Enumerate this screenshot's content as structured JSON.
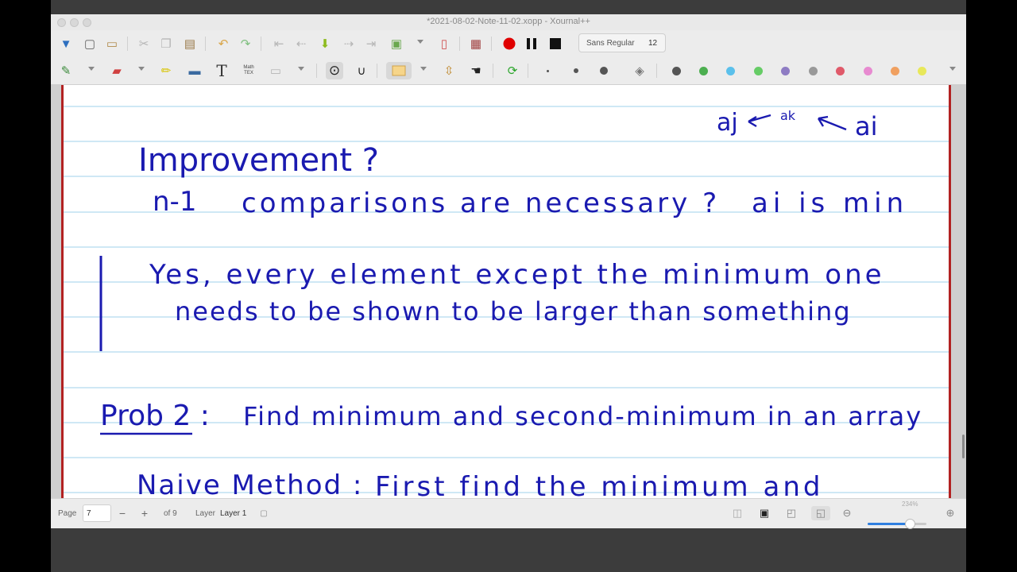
{
  "window": {
    "title": "*2021-08-02-Note-11-02.xopp - Xournal++"
  },
  "toolbar": {
    "font_name": "Sans Regular",
    "font_size": "12",
    "math_tex_label_top": "Math",
    "math_tex_label_bottom": "TEX",
    "text_tool_label": "T",
    "pen_color": "#1a1ab0",
    "palette": [
      "#555555",
      "#4caf50",
      "#5bc0eb",
      "#66cc66",
      "#8e7cc3",
      "#999999",
      "#e05a6a",
      "#e78ad0",
      "#f0a060",
      "#e8e85a"
    ],
    "record_color": "#e00000"
  },
  "note": {
    "annotation_top_right": [
      "aj",
      "ak",
      "ai"
    ],
    "line1": "Improvement ?",
    "line2_a": "n-1",
    "line2_b": "comparisons are necessary ?",
    "line2_c": "ai is min",
    "line3": "Yes, every element except the minimum one",
    "line4": "needs to be shown to be larger than something",
    "line5_label": "Prob 2 :",
    "line5_text": "Find minimum and second-minimum in an array",
    "line6_label": "Naive Method :",
    "line6_text": "First find the minimum and"
  },
  "status": {
    "page_label": "Page",
    "page_value": "7",
    "of_pages": "of 9",
    "layer_label": "Layer",
    "layer_value": "Layer 1",
    "zoom_label": "234%",
    "zoom_level_fraction": 0.72
  }
}
